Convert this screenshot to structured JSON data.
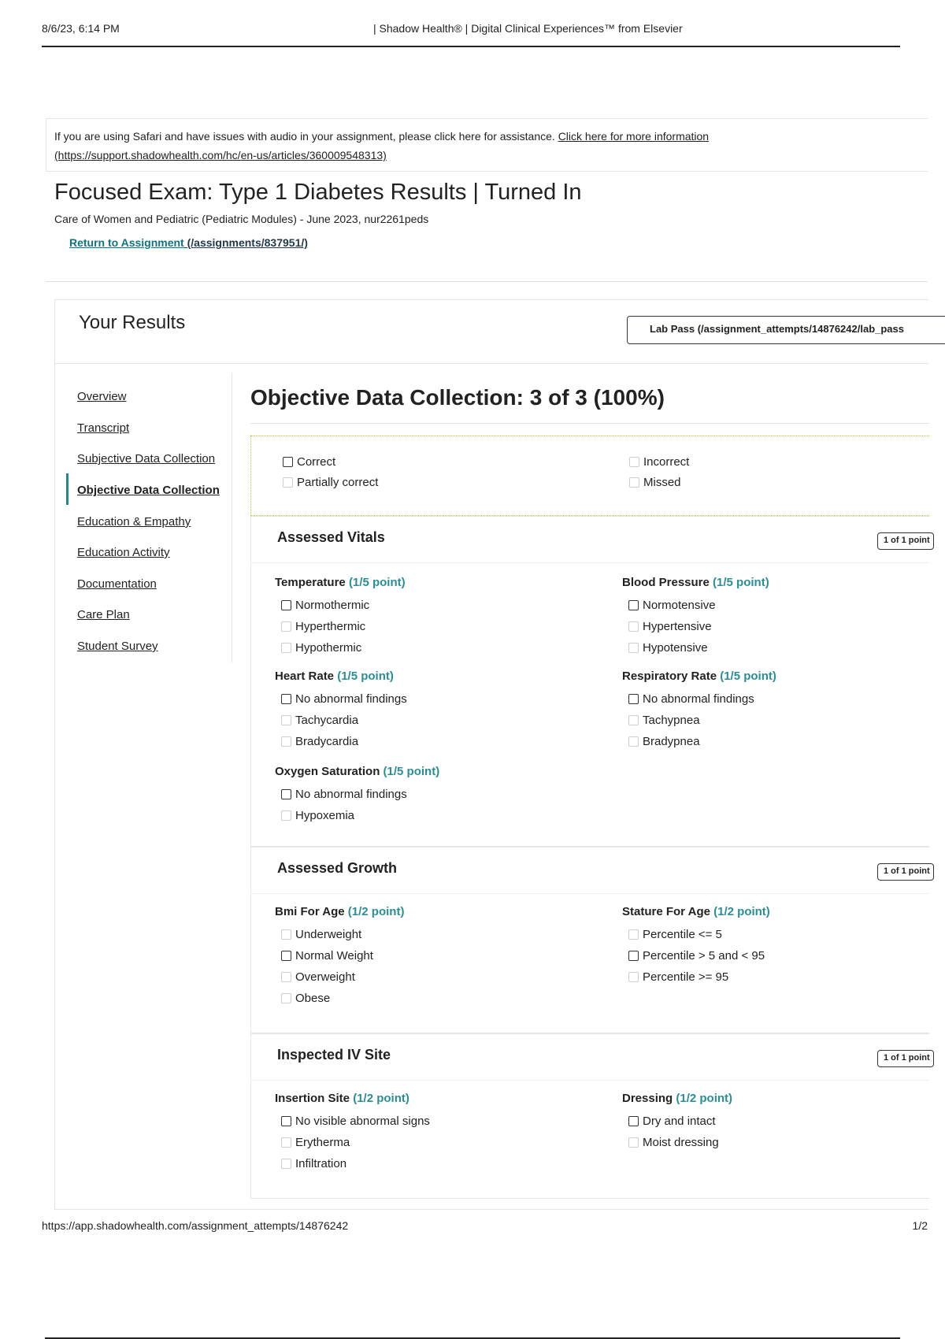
{
  "print_header": {
    "date": "8/6/23, 6:14 PM",
    "title": "| Shadow Health® | Digital Clinical Experiences™ from Elsevier"
  },
  "notice": {
    "text": "If you are using Safari and have issues with audio in your assignment, please click here for assistance. ",
    "link_text": "Click here for more information",
    "link_url_text": "(https://support.shadowhealth.com/hc/en-us/articles/360009548313)"
  },
  "page": {
    "title": "Focused Exam: Type 1 Diabetes Results | Turned In",
    "course": "Care of Women and Pediatric (Pediatric Modules) - June 2023, nur2261peds",
    "return_link": "Return to Assignment",
    "return_path": " (/assignments/837951/)"
  },
  "results": {
    "heading": "Your Results",
    "lab_pass": "Lab Pass (/assignment_attempts/14876242/lab_pass"
  },
  "sidebar": {
    "items": [
      {
        "label": "Overview"
      },
      {
        "label": "Transcript"
      },
      {
        "label": "Subjective Data Collection"
      },
      {
        "label": "Objective Data Collection"
      },
      {
        "label": "Education & Empathy"
      },
      {
        "label": "Education Activity"
      },
      {
        "label": "Documentation"
      },
      {
        "label": "Care Plan"
      },
      {
        "label": "Student Survey"
      }
    ]
  },
  "main": {
    "heading": "Objective Data Collection: 3 of 3 (100%)",
    "legend": {
      "correct": "Correct",
      "partially_correct": "Partially correct",
      "incorrect": "Incorrect",
      "missed": "Missed"
    }
  },
  "sections": [
    {
      "title": "Assessed Vitals",
      "badge": "1 of 1 point",
      "questions": [
        {
          "title": "Temperature",
          "points": "(1/5 point)",
          "options": [
            "Normothermic",
            "Hyperthermic",
            "Hypothermic"
          ]
        },
        {
          "title": "Blood Pressure",
          "points": "(1/5 point)",
          "options": [
            "Normotensive",
            "Hypertensive",
            "Hypotensive"
          ]
        },
        {
          "title": "Heart Rate",
          "points": "(1/5 point)",
          "options": [
            "No abnormal findings",
            "Tachycardia",
            "Bradycardia"
          ]
        },
        {
          "title": "Respiratory Rate",
          "points": "(1/5 point)",
          "options": [
            "No abnormal findings",
            "Tachypnea",
            "Bradypnea"
          ]
        },
        {
          "title": "Oxygen Saturation",
          "points": "(1/5 point)",
          "options": [
            "No abnormal findings",
            "Hypoxemia"
          ]
        }
      ]
    },
    {
      "title": "Assessed Growth",
      "badge": "1 of 1 point",
      "questions": [
        {
          "title": "Bmi For Age",
          "points": "(1/2 point)",
          "options": [
            "Underweight",
            "Normal Weight",
            "Overweight",
            "Obese"
          ]
        },
        {
          "title": "Stature For Age",
          "points": "(1/2 point)",
          "options": [
            "Percentile <= 5",
            "Percentile > 5 and < 95",
            "Percentile >= 95"
          ]
        }
      ]
    },
    {
      "title": "Inspected IV Site",
      "badge": "1 of 1 point",
      "questions": [
        {
          "title": "Insertion Site",
          "points": "(1/2 point)",
          "options": [
            "No visible abnormal signs",
            "Erytherma",
            "Infiltration"
          ]
        },
        {
          "title": "Dressing",
          "points": "(1/2 point)",
          "options": [
            "Dry and intact",
            "Moist dressing"
          ]
        }
      ]
    }
  ],
  "print_footer": {
    "url": "https://app.shadowhealth.com/assignment_attempts/14876242",
    "page": "1/2"
  }
}
